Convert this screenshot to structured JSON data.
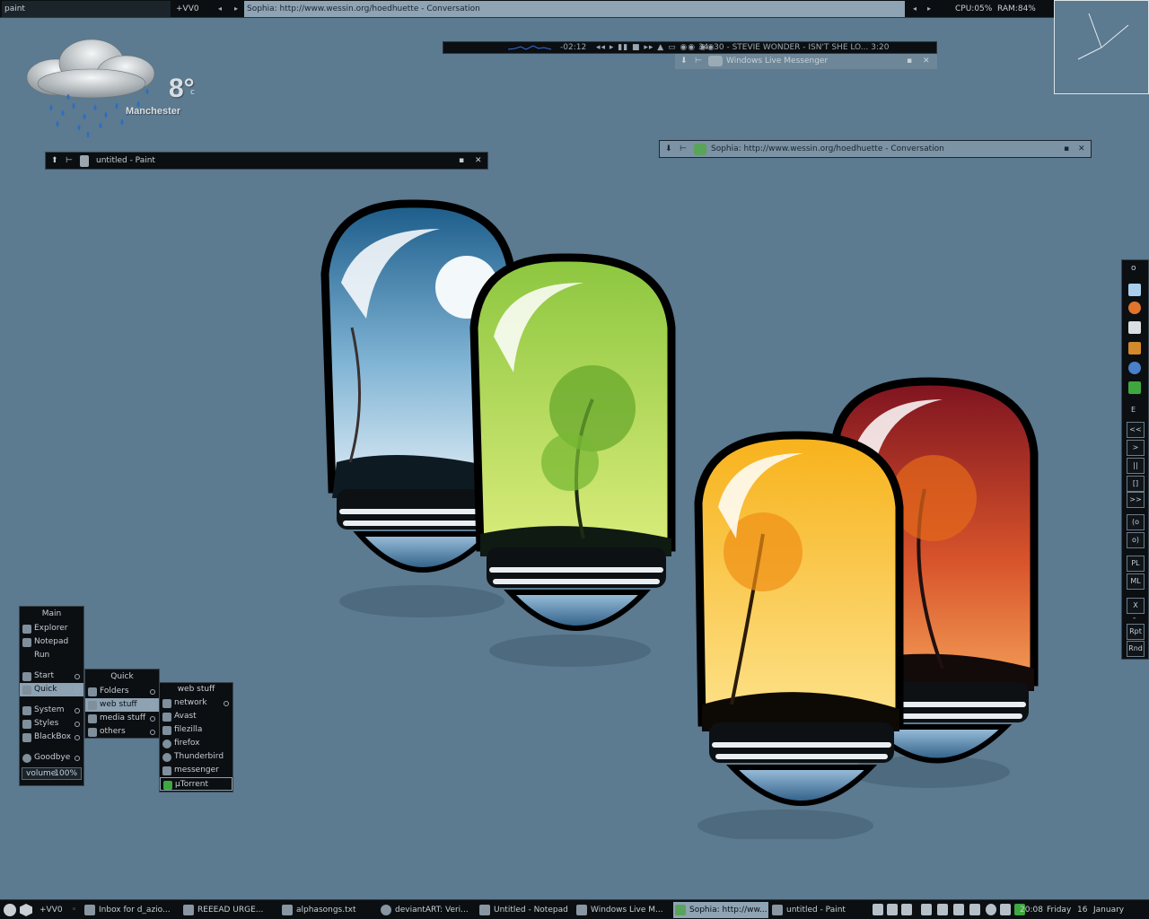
{
  "topbar": {
    "workspace_label": "paint",
    "desktop_name": "+VV0",
    "window_title": "Sophia:   http://www.wessin.org/hoedhuette   -   Conversation",
    "cpu": "CPU:05%",
    "ram": "RAM:84%"
  },
  "weather": {
    "temperature": "8°",
    "unit": "c",
    "city": "Manchester",
    "icon": "rain-cloud-icon"
  },
  "player": {
    "time": "-02:12",
    "track": "34. 30 - STEVIE WONDER - ISN'T SHE LO...  3:20"
  },
  "windows": {
    "messenger_collapsed": "Windows   Live   Messenger",
    "paint": "untitled   -   Paint",
    "conversation": "Sophia:   http://www.wessin.org/hoedhuette   -   Conversation"
  },
  "dock": {
    "top_dot": "o",
    "separator_label": "E",
    "buttons": [
      "<<",
      ">",
      "||",
      "[]",
      ">>",
      "(o",
      "o)",
      "PL",
      "ML",
      "X",
      "-",
      "Rpt",
      "Rnd"
    ],
    "icons": [
      "document-icon",
      "firefox-icon",
      "monitor-icon",
      "filezilla-icon",
      "thunderbird-icon",
      "utorrent-icon"
    ]
  },
  "menus": {
    "main": {
      "title": "Main",
      "items": [
        "Explorer",
        "Notepad",
        "Run"
      ],
      "items2": [
        "Start",
        "Quick"
      ],
      "items3": [
        "System",
        "Styles",
        "BlackBox"
      ],
      "goodbye": "Goodbye",
      "volume": "volume",
      "volume_value": "100%"
    },
    "quick": {
      "title": "Quick",
      "items": [
        "Folders",
        "web   stuff",
        "media   stuff",
        "others"
      ]
    },
    "web": {
      "title": "web   stuff",
      "items": [
        "network",
        "Avast",
        "filezilla",
        "firefox",
        "Thunderbird",
        "messenger",
        "µTorrent"
      ]
    }
  },
  "taskbar": {
    "desktop": "+VV0",
    "tasks": [
      "Inbox   for   d_azio...",
      "REEEAD   URGE...",
      "alphasongs.txt",
      "deviantART:   Veri...",
      "Untitled   -   Notepad",
      "Windows   Live   M...",
      "Sophia:   http://ww...",
      "untitled   -   Paint"
    ],
    "clock": "20:08",
    "day": "Friday",
    "date": "16",
    "month": "January"
  },
  "colors": {
    "desktop": "#5c7a90",
    "bar": "#0b0f12",
    "highlight": "#8ea3b3"
  }
}
